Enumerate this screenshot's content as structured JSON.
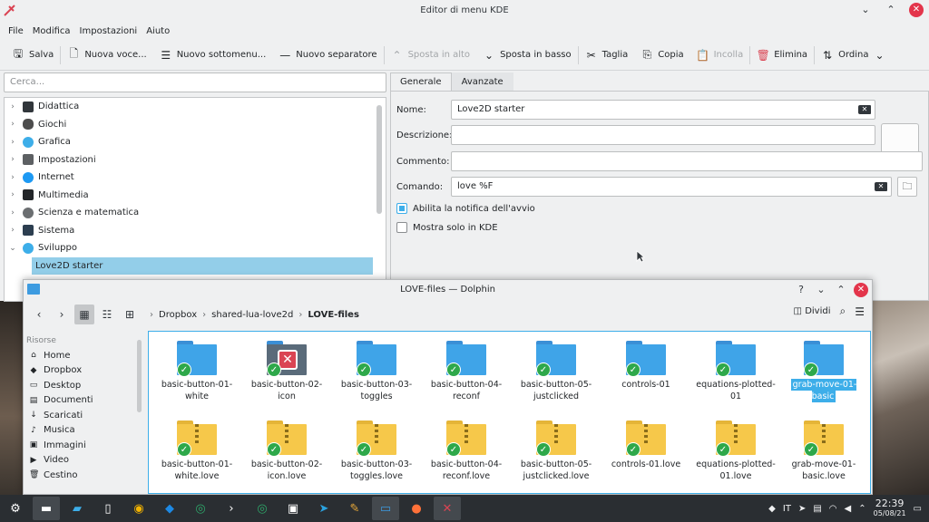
{
  "editor": {
    "title": "Editor di menu KDE",
    "menu": [
      "File",
      "Modifica",
      "Impostazioni",
      "Aiuto"
    ],
    "toolbar": {
      "save": "Salva",
      "new_item": "Nuova voce...",
      "new_submenu": "Nuovo sottomenu...",
      "new_separator": "Nuovo separatore",
      "move_up": "Sposta in alto",
      "move_down": "Sposta in basso",
      "cut": "Taglia",
      "copy": "Copia",
      "paste": "Incolla",
      "delete": "Elimina",
      "sort": "Ordina"
    },
    "search_placeholder": "Cerca...",
    "tree": [
      {
        "label": "Didattica",
        "color": "#31363b"
      },
      {
        "label": "Giochi",
        "color": "#4d4d4d"
      },
      {
        "label": "Grafica",
        "color": "#3daee9"
      },
      {
        "label": "Impostazioni",
        "color": "#5d6063"
      },
      {
        "label": "Internet",
        "color": "#1d99f3"
      },
      {
        "label": "Multimedia",
        "color": "#232629"
      },
      {
        "label": "Scienza e matematica",
        "color": "#6b6e71"
      },
      {
        "label": "Sistema",
        "color": "#2c3e50"
      },
      {
        "label": "Sviluppo",
        "color": "#3daee9"
      }
    ],
    "selected_child": "Love2D starter",
    "tabs": [
      "Generale",
      "Avanzate"
    ],
    "form": {
      "name_label": "Nome:",
      "name_value": "Love2D starter",
      "desc_label": "Descrizione:",
      "comment_label": "Commento:",
      "command_label": "Comando:",
      "command_value": "love %F",
      "check1": "Abilita la notifica dell'avvio",
      "check2": "Mostra solo in KDE"
    }
  },
  "dolphin": {
    "title": "LOVE-files — Dolphin",
    "breadcrumb": [
      "Dropbox",
      "shared-lua-love2d",
      "LOVE-files"
    ],
    "split": "Dividi",
    "places_header": "Risorse",
    "places": [
      {
        "label": "Home",
        "icon": "⌂"
      },
      {
        "label": "Dropbox",
        "icon": "◆"
      },
      {
        "label": "Desktop",
        "icon": "▭"
      },
      {
        "label": "Documenti",
        "icon": "▤"
      },
      {
        "label": "Scaricati",
        "icon": "↓"
      },
      {
        "label": "Musica",
        "icon": "♪"
      },
      {
        "label": "Immagini",
        "icon": "▣"
      },
      {
        "label": "Video",
        "icon": "▶"
      },
      {
        "label": "Cestino",
        "icon": "🗑"
      }
    ],
    "folders": [
      {
        "name": "basic-button-01-white",
        "error": false
      },
      {
        "name": "basic-button-02-icon",
        "error": true
      },
      {
        "name": "basic-button-03-toggles",
        "error": false
      },
      {
        "name": "basic-button-04-reconf",
        "error": false
      },
      {
        "name": "basic-button-05-justclicked",
        "error": false
      },
      {
        "name": "controls-01",
        "error": false
      },
      {
        "name": "equations-plotted-01",
        "error": false
      },
      {
        "name": "grab-move-01-basic",
        "error": false,
        "selected": true
      }
    ],
    "files": [
      "basic-button-01-white.love",
      "basic-button-02-icon.love",
      "basic-button-03-toggles.love",
      "basic-button-04-reconf.love",
      "basic-button-05-justclicked.love",
      "controls-01.love",
      "equations-plotted-01.love",
      "grab-move-01-basic.love"
    ]
  },
  "panel": {
    "time": "22:39",
    "date": "05/08/21"
  }
}
